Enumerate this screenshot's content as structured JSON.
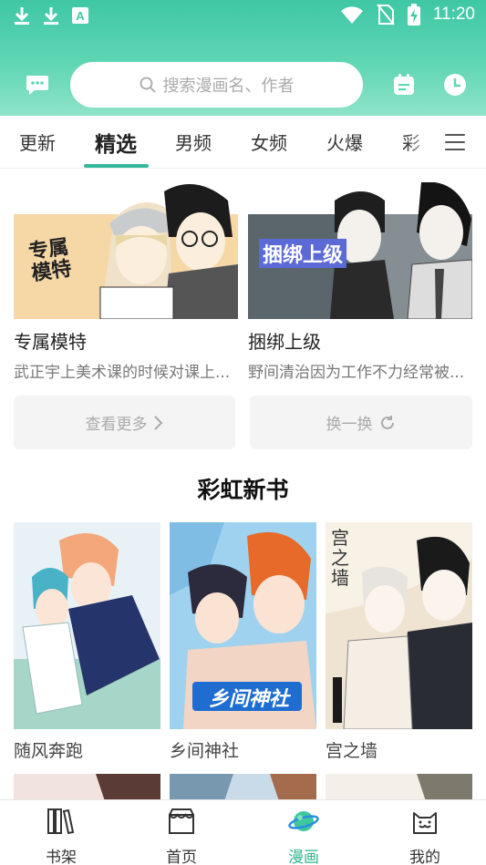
{
  "status_bar": {
    "time": "11:20"
  },
  "search": {
    "placeholder": "搜索漫画名、作者"
  },
  "tabs": [
    {
      "label": "更新"
    },
    {
      "label": "精选"
    },
    {
      "label": "男频"
    },
    {
      "label": "女频"
    },
    {
      "label": "火爆"
    },
    {
      "label": "彩"
    }
  ],
  "active_tab": "精选",
  "featured": [
    {
      "title": "专属模特",
      "desc": "武正宇上美术课的时候对课上...",
      "cover_text": "专属模特"
    },
    {
      "title": "捆绑上级",
      "desc": "野间清治因为工作不力经常被...",
      "cover_text": "捆绑上级"
    }
  ],
  "actions": {
    "more": "查看更多",
    "refresh": "换一换"
  },
  "section": {
    "title": "彩虹新书"
  },
  "books": [
    {
      "name": "随风奔跑"
    },
    {
      "name": "乡间神社",
      "cover_text": "乡间神社"
    },
    {
      "name": "宫之墙",
      "cover_text": "宫之墙"
    }
  ],
  "bottom_nav": [
    {
      "label": "书架",
      "icon": "bookshelf-icon"
    },
    {
      "label": "首页",
      "icon": "shop-icon"
    },
    {
      "label": "漫画",
      "icon": "planet-icon"
    },
    {
      "label": "我的",
      "icon": "cat-face-icon"
    }
  ],
  "colors": {
    "accent": "#34b99a",
    "header_top": "#3fc7a4",
    "header_bottom": "#8fe3c9"
  }
}
